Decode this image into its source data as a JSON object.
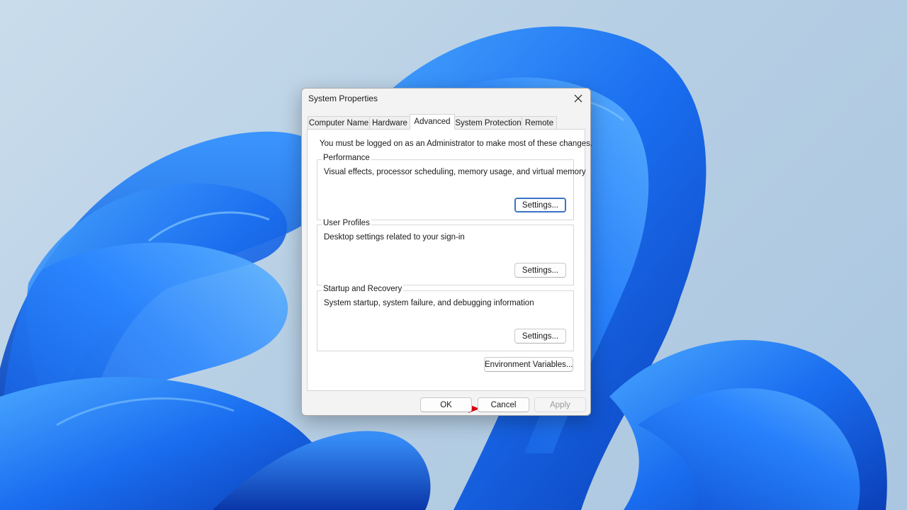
{
  "window": {
    "title": "System Properties"
  },
  "tabs": [
    {
      "label": "Computer Name",
      "active": false
    },
    {
      "label": "Hardware",
      "active": false
    },
    {
      "label": "Advanced",
      "active": true
    },
    {
      "label": "System Protection",
      "active": false
    },
    {
      "label": "Remote",
      "active": false
    }
  ],
  "advanced": {
    "admin_note": "You must be logged on as an Administrator to make most of these changes.",
    "performance": {
      "title": "Performance",
      "description": "Visual effects, processor scheduling, memory usage, and virtual memory",
      "button": "Settings..."
    },
    "user_profiles": {
      "title": "User Profiles",
      "description": "Desktop settings related to your sign-in",
      "button": "Settings..."
    },
    "startup_recovery": {
      "title": "Startup and Recovery",
      "description": "System startup, system failure, and debugging information",
      "button": "Settings..."
    },
    "env_button": "Environment Variables..."
  },
  "footer": {
    "ok": "OK",
    "cancel": "Cancel",
    "apply": "Apply",
    "apply_enabled": false
  },
  "icons": {
    "close": "close-icon",
    "annotation_arrow": "red-arrow-icon"
  },
  "colors": {
    "accent": "#3b73c4",
    "annotation_arrow": "#d6000f",
    "wallpaper_blue": "#1a6ef0"
  }
}
